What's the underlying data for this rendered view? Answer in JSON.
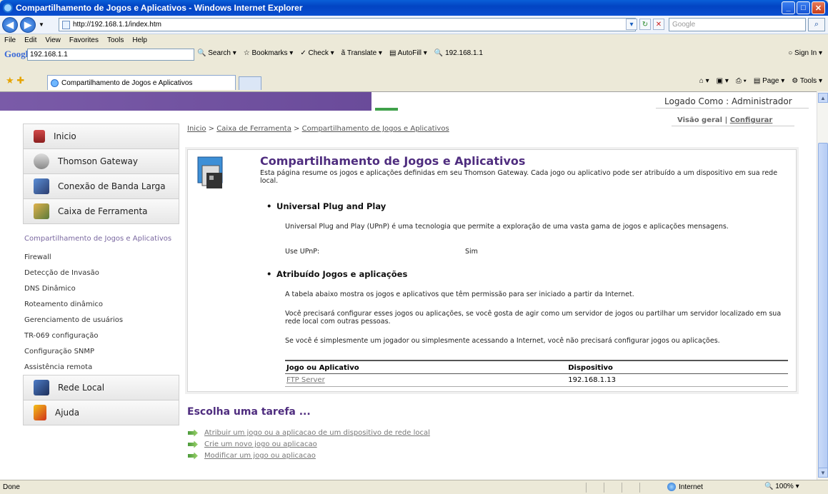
{
  "window": {
    "title": "Compartilhamento de Jogos e Aplicativos - Windows Internet Explorer"
  },
  "address": {
    "url": "http://192.168.1.1/index.htm",
    "search_placeholder": "Google"
  },
  "menu": [
    "File",
    "Edit",
    "View",
    "Favorites",
    "Tools",
    "Help"
  ],
  "google_bar": {
    "logo": "Google",
    "query": "192.168.1.1",
    "buttons": [
      "Search",
      "Bookmarks",
      "Check",
      "Translate",
      "AutoFill",
      "192.168.1.1"
    ],
    "sign_in": "Sign In"
  },
  "tab": {
    "title": "Compartilhamento de Jogos e Aplicativos"
  },
  "commands": {
    "page": "Page",
    "tools": "Tools"
  },
  "header": {
    "logged_in": "Logado Como : Administrador",
    "overview": "Visão geral",
    "separator": "|",
    "configure": "Configurar"
  },
  "breadcrumb": {
    "home": "Inicio",
    "sep": ">",
    "tools": "Caixa de Ferramenta",
    "current": "Compartilhamento de Jogos e Aplicativos"
  },
  "nav": {
    "main": [
      "Inicio",
      "Thomson Gateway",
      "Conexão de Banda Larga",
      "Caixa de Ferramenta"
    ],
    "sub": [
      "Compartilhamento de Jogos e Aplicativos",
      "Firewall",
      "Detecção de Invasão",
      "DNS Dinâmico",
      "Roteamento dinâmico",
      "Gerenciamento de usuários",
      "TR-069 configuração",
      "Configuração SNMP",
      "Assistência remota"
    ],
    "bottom": [
      "Rede Local",
      "Ajuda"
    ]
  },
  "main": {
    "title": "Compartilhamento de Jogos e Aplicativos",
    "intro": "Esta página resume os jogos e aplicações definidas em seu Thomson Gateway. Cada jogo ou aplicativo pode ser atribuído a um dispositivo em sua rede local.",
    "upnp_heading": "Universal Plug and Play",
    "upnp_text": "Universal Plug and Play (UPnP) é uma tecnologia que permite a exploração de uma vasta gama de jogos e aplicações mensagens.",
    "use_upnp_label": "Use UPnP:",
    "use_upnp_value": "Sim",
    "assigned_heading": "Atribuído Jogos e aplicações",
    "assigned_text1": "A tabela abaixo mostra os jogos e aplicativos que têm permissão para ser iniciado a partir da Internet.",
    "assigned_text2": "Você precisará configurar esses jogos ou aplicações, se você gosta de agir como um servidor de jogos ou partilhar um servidor localizado em sua rede local com outras pessoas.",
    "assigned_text3": "Se você é simplesmente um jogador ou simplesmente acessando a Internet, você não precisará configurar jogos ou aplicações.",
    "table": {
      "headers": [
        "Jogo ou Aplicativo",
        "Dispositivo"
      ],
      "rows": [
        [
          "FTP Server",
          "192.168.1.13"
        ]
      ]
    }
  },
  "tasks": {
    "heading": "Escolha uma tarefa ...",
    "items": [
      "Atribuir um jogo ou a aplicacao de um dispositivo de rede local",
      "Crie um novo jogo ou aplicacao",
      "Modificar um jogo ou aplicacao"
    ]
  },
  "status": {
    "text": "Done",
    "zone": "Internet",
    "zoom": "100%"
  }
}
